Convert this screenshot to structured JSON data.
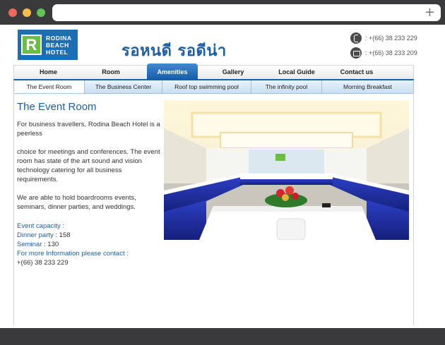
{
  "browser": {
    "new_tab": "+"
  },
  "header": {
    "logo_letter": "R",
    "logo_lines": [
      "RODINA",
      "BEACH",
      "HOTEL"
    ],
    "thai_title": "รอหนดี  รอดีน่า",
    "phone": ": +(66) 38 233 229",
    "fax": ": +(66) 38 233 209"
  },
  "nav": {
    "items": [
      "Home",
      "Room",
      "Amenities",
      "Gallery",
      "Local Guide",
      "Contact us"
    ],
    "active": "Amenities"
  },
  "subnav": {
    "items": [
      "The Event Room",
      "The Business Center",
      "Roof top swimming pool",
      "The infinity pool",
      "Morning Breakfast"
    ],
    "active": "The Event Room"
  },
  "content": {
    "title": "The Event Room",
    "para1": "For business travellers, Rodina Beach Hotel is a peerless",
    "para2": "choice for meetings and conferences. The event room has state of the art sound and vision technology catering for all business requirements.",
    "para3": "We are able to hold boardrooms events, seminars, dinner parties, and weddings.",
    "capacity_label": "Event capacity :",
    "dinner_label": "Dinner party",
    "dinner_value": ": 158",
    "seminar_label": "Seminar",
    "seminar_value": ": 130",
    "contact_label": "For more Information please contact :",
    "contact_phone": "+(66) 38 233 229"
  },
  "colors": {
    "brand_blue": "#1d5fa6",
    "brand_green": "#6cbe45",
    "tablecloth_blue": "#1f2fa8"
  }
}
